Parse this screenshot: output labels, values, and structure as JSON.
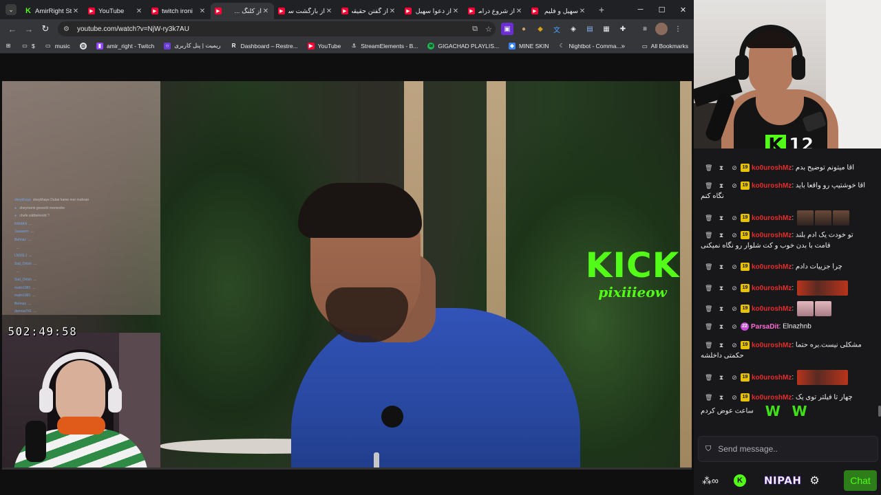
{
  "browser": {
    "tabs": [
      {
        "title": "AmirRight St",
        "favicon": "kick-icon",
        "active": false
      },
      {
        "title": "YouTube",
        "favicon": "youtube-icon",
        "active": false
      },
      {
        "title": "twitch ironi",
        "favicon": "youtube-icon",
        "active": false
      },
      {
        "title": "از کلنگ ...",
        "favicon": "youtube-icon",
        "active": true
      },
      {
        "title": "از بازگشت سا",
        "favicon": "youtube-icon",
        "active": false
      },
      {
        "title": "از گفتن حقیقت",
        "favicon": "youtube-icon",
        "active": false
      },
      {
        "title": "از دعوا سهیل",
        "favicon": "youtube-icon",
        "active": false
      },
      {
        "title": "از شروع دراما",
        "favicon": "youtube-icon",
        "active": false
      },
      {
        "title": "سهیل و فلیم",
        "favicon": "youtube-icon",
        "active": false
      }
    ],
    "url": "youtube.com/watch?v=NjW-ry3k7AU",
    "bookmarks": [
      {
        "label": "$",
        "icon": "folder-icon"
      },
      {
        "label": "music",
        "icon": "folder-icon"
      },
      {
        "label": "",
        "icon": "globe-icon"
      },
      {
        "label": "amir_right - Twitch",
        "icon": "twitch-icon"
      },
      {
        "label": "ریمیت | پنل کاربری",
        "icon": "remit-icon"
      },
      {
        "label": "Dashboard – Restre...",
        "icon": "restream-icon"
      },
      {
        "label": "YouTube",
        "icon": "youtube-icon"
      },
      {
        "label": "StreamElements - B...",
        "icon": "streamelements-icon"
      },
      {
        "label": "GIGACHAD PLAYLIS...",
        "icon": "spotify-icon"
      },
      {
        "label": "MINE SKIN",
        "icon": "mineskin-icon"
      },
      {
        "label": "Nightbot - Comma...",
        "icon": "nightbot-icon"
      }
    ],
    "all_bookmarks": "All Bookmarks"
  },
  "video": {
    "watermark_brand": "KICK",
    "watermark_handle": "pixiiieow",
    "clock": "502:49:58",
    "overlay_chat": [
      {
        "user": "sheykhaye",
        "text": "sheykhaye Dubai hame mer mahsan"
      },
      {
        "user": "● ",
        "text": "sheyroomi gooesht memeshe"
      },
      {
        "user": "● ",
        "text": "chefe sidtbehesht ?"
      },
      {
        "user": "RAMAN",
        "text": "..."
      },
      {
        "user": "Jaaaaom",
        "text": "..."
      },
      {
        "user": "Behnaz",
        "text": "..."
      },
      {
        "user": "",
        "text": "..."
      },
      {
        "user": "LNSSLJ",
        "text": "..."
      },
      {
        "user": "Sad_Oriish",
        "text": "..."
      },
      {
        "user": "",
        "text": "..."
      },
      {
        "user": "Sad_Oriish",
        "text": "..."
      },
      {
        "user": "matin1981",
        "text": "..."
      },
      {
        "user": "matin1981",
        "text": "..."
      },
      {
        "user": "Behnaz",
        "text": "..."
      },
      {
        "user": "durnow741",
        "text": "..."
      }
    ]
  },
  "stream": {
    "viewer_count": "12",
    "chat": [
      {
        "user": "ko0uroshMz",
        "badge": "19",
        "text": "اقا میتونم توضیح بدم",
        "emotes": 0,
        "wrap": ""
      },
      {
        "user": "ko0uroshMz",
        "badge": "19",
        "text": "اقا خوشتیپ رو واقعا باید",
        "emotes": 0,
        "wrap": "نگاه کنم"
      },
      {
        "user": "ko0uroshMz",
        "badge": "19",
        "text": "",
        "emotes": 3,
        "wrap": ""
      },
      {
        "user": "ko0uroshMz",
        "badge": "19",
        "text": "تو خودت یک ادم بلند",
        "emotes": 0,
        "wrap": "قامت با بدن خوب و کت شلوار رو نگاه نمیکنی"
      },
      {
        "user": "ko0uroshMz",
        "badge": "19",
        "text": "چرا جزییات دادم",
        "emotes": 0,
        "wrap": ""
      },
      {
        "user": "ko0uroshMz",
        "badge": "19",
        "text": "",
        "emotes": 1,
        "wrap": ""
      },
      {
        "user": "ko0uroshMz",
        "badge": "19",
        "text": "",
        "emotes": 2,
        "wrap": ""
      },
      {
        "user": "ParsaDit",
        "badge": "22",
        "text": "Elnazhnb",
        "emotes": 0,
        "wrap": ""
      },
      {
        "user": "ko0uroshMz",
        "badge": "19",
        "text": "مشکلی نیست.بره حتما",
        "emotes": 0,
        "wrap": "حکمتی داخلشه"
      },
      {
        "user": "ko0uroshMz",
        "badge": "19",
        "text": "",
        "emotes": 1,
        "wrap": ""
      },
      {
        "user": "ko0uroshMz",
        "badge": "19",
        "text": "چهار تا فیلتر توی یک",
        "emotes": 0,
        "wrap": "ساعت عوض کردم"
      }
    ],
    "emote_w": "W",
    "input_placeholder": "Send message..",
    "footer_brand": "NIPAH",
    "chat_button": "Chat",
    "accent": "#53fc18",
    "username_color": "#e72c2c"
  }
}
